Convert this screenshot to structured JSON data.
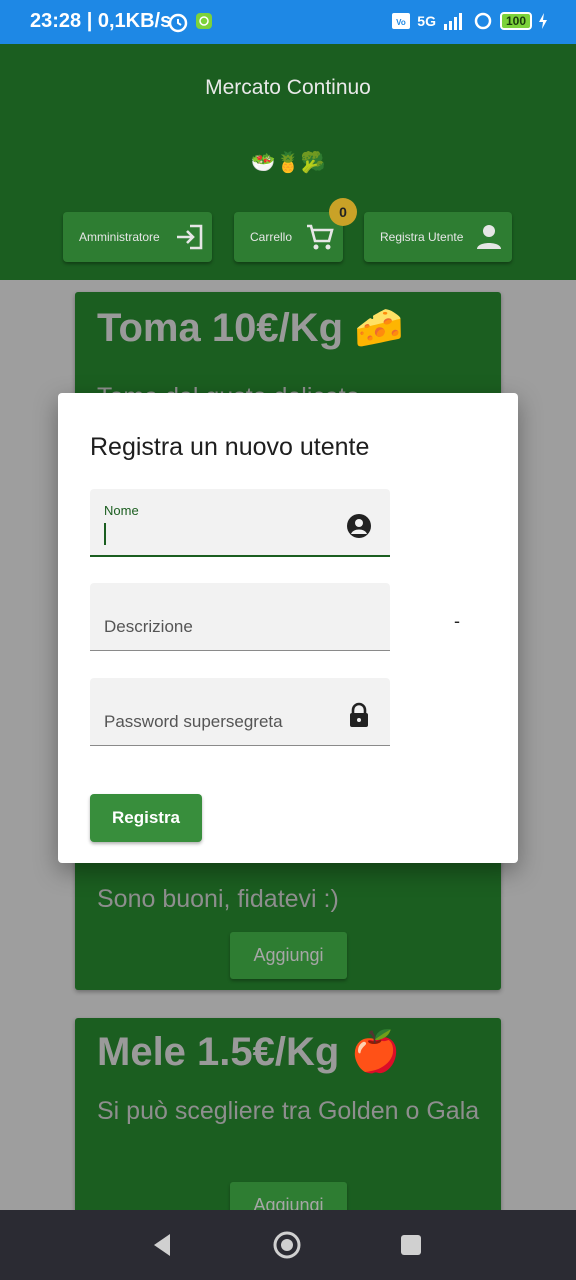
{
  "status_bar": {
    "time_speed": "23:28 | 0,1KB/s",
    "network": "5G",
    "battery": "100",
    "icons": [
      "alarm-icon",
      "app-notification-icon",
      "volte-icon",
      "signal-icon",
      "data-saver-icon",
      "battery-icon",
      "charging-icon"
    ]
  },
  "header": {
    "title": "Mercato Continuo",
    "emojis": "🥗🍍🥦",
    "buttons": {
      "admin": "Amministratore",
      "cart": "Carrello",
      "cart_count": "0",
      "register": "Registra Utente"
    }
  },
  "products": [
    {
      "title": "Toma 10€/Kg 🧀",
      "description": "Toma dal gusto delicato"
    },
    {
      "description": "Sono buoni, fidatevi :)",
      "add_label": "Aggiungi"
    },
    {
      "title": "Mele 1.5€/Kg 🍎",
      "description": "Si può scegliere tra Golden o Gala",
      "add_label": "Aggiungi"
    }
  ],
  "dialog": {
    "title": "Registra un nuovo utente",
    "name_label": "Nome",
    "name_value": "",
    "description_placeholder": "Descrizione",
    "password_placeholder": "Password supersegreta",
    "dash": "-",
    "submit_label": "Registra"
  },
  "colors": {
    "status_bar": "#1e88e5",
    "app_green": "#1b5e20",
    "button_green": "#2e7d32",
    "submit_green": "#388e3c",
    "badge": "#c9a227",
    "nav_bar": "#2b2b33"
  }
}
